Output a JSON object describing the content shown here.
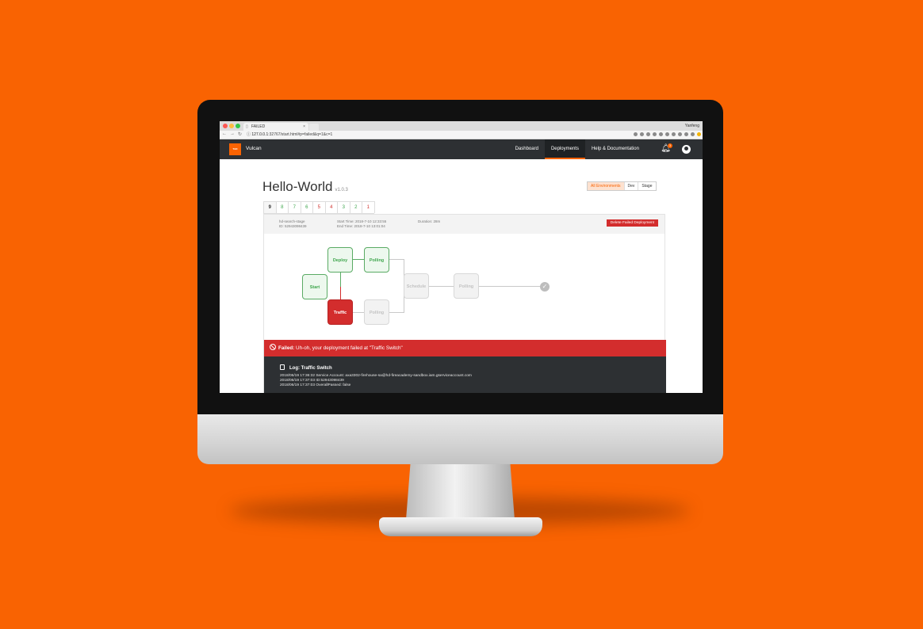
{
  "colors": {
    "background": "#f96302",
    "nav": "#2d3033",
    "success": "#3fa64d",
    "failure": "#d32d2d",
    "pending": "#c3c3c3"
  },
  "browser": {
    "tab_title": "FAILED",
    "user": "Yanfeng",
    "url_host": "127.0.0.1",
    "url_rest": ":32767/start.html#p=failed&q=1&c=1"
  },
  "app": {
    "brand": "Vulcan",
    "logo_text": "THE HOME DEPOT",
    "nav": [
      "Dashboard",
      "Deployments",
      "Help & Documentation"
    ],
    "active_nav": "Deployments",
    "notification_count": "3"
  },
  "page": {
    "title": "Hello-World",
    "version": "v1.0.3",
    "environments": [
      "All Environments",
      "Dev",
      "Stage"
    ],
    "active_environment": "All Environments"
  },
  "deployment_tabs": [
    {
      "label": "9",
      "status": "active"
    },
    {
      "label": "8",
      "status": "success"
    },
    {
      "label": "7",
      "status": "success"
    },
    {
      "label": "6",
      "status": "success"
    },
    {
      "label": "5",
      "status": "failed"
    },
    {
      "label": "4",
      "status": "failed"
    },
    {
      "label": "3",
      "status": "success"
    },
    {
      "label": "2",
      "status": "success"
    },
    {
      "label": "1",
      "status": "failed"
    }
  ],
  "deployment": {
    "name": "hd-search-stage",
    "id": "ID: 52943098439",
    "start_time": "Start Time: 2018-7-10  12:33:55",
    "end_time": "End Time: 2018-7-10  13:01:04",
    "duration": "Duration: 28m",
    "delete_label": "Delete Failed Deployment"
  },
  "pipeline": {
    "start": {
      "label": "Start",
      "status": "success"
    },
    "deploy": {
      "label": "Deploy",
      "status": "success"
    },
    "polling_top": {
      "label": "Polling",
      "status": "success"
    },
    "traffic": {
      "label": "Traffic",
      "status": "failed"
    },
    "polling_bottom": {
      "label": "Polling",
      "status": "pending"
    },
    "schedule": {
      "label": "Schedule",
      "status": "pending"
    },
    "polling_final": {
      "label": "Polling",
      "status": "pending"
    },
    "end_icon": "check-icon"
  },
  "alert": {
    "prefix": "Failed:",
    "message": "Uh-oh, your deployment failed at \"Traffic Switch\""
  },
  "log": {
    "title": "Log: Traffic Switch",
    "lines": [
      "2018/06/19 17:36:32 Service Account: axa3302-firehouse-sa@hd-fireacademy-sandbox.iam.gserviceaccount.com",
      "2018/06/19 17:37:03 ID:52943098439",
      "2018/06/19 17:37:03 OverallPassed: false"
    ]
  }
}
